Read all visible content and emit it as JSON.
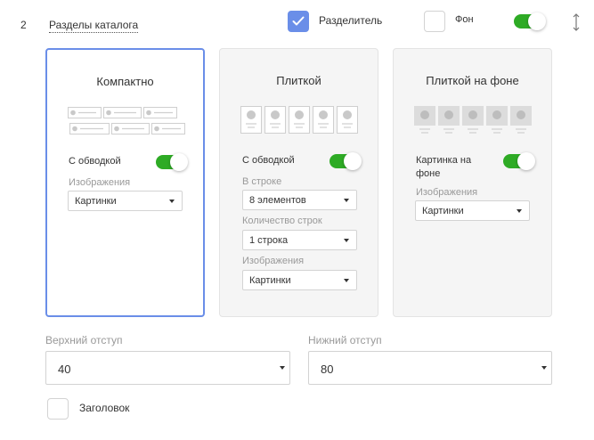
{
  "header": {
    "index": "2",
    "section_title": "Разделы каталога",
    "separator_label": "Разделитель",
    "separator_checked": true,
    "background_label": "Фон",
    "background_checked": false,
    "visible_toggle_on": true
  },
  "icons": {
    "check": "check-icon",
    "drag": "drag-handle-icon",
    "caret": "caret-down-icon"
  },
  "cards": [
    {
      "title": "Компактно",
      "selected": true,
      "border_toggle_label": "С обводкой",
      "border_toggle_on": true,
      "images_label": "Изображения",
      "images_value": "Картинки"
    },
    {
      "title": "Плиткой",
      "selected": false,
      "border_toggle_label": "С обводкой",
      "border_toggle_on": true,
      "per_row_label": "В строке",
      "per_row_value": "8 элементов",
      "rows_label": "Количество строк",
      "rows_value": "1 строка",
      "images_label": "Изображения",
      "images_value": "Картинки"
    },
    {
      "title": "Плиткой на фоне",
      "selected": false,
      "bg_image_label_line1": "Картинка на",
      "bg_image_label_line2": "фоне",
      "bg_image_toggle_on": true,
      "images_label": "Изображения",
      "images_value": "Картинки"
    }
  ],
  "padding": {
    "top_label": "Верхний отступ",
    "top_value": "40",
    "bottom_label": "Нижний отступ",
    "bottom_value": "80"
  },
  "heading_checkbox": {
    "label": "Заголовок",
    "checked": false
  },
  "colors": {
    "accent_blue": "#6a8ee8",
    "toggle_green": "#2eab25"
  }
}
